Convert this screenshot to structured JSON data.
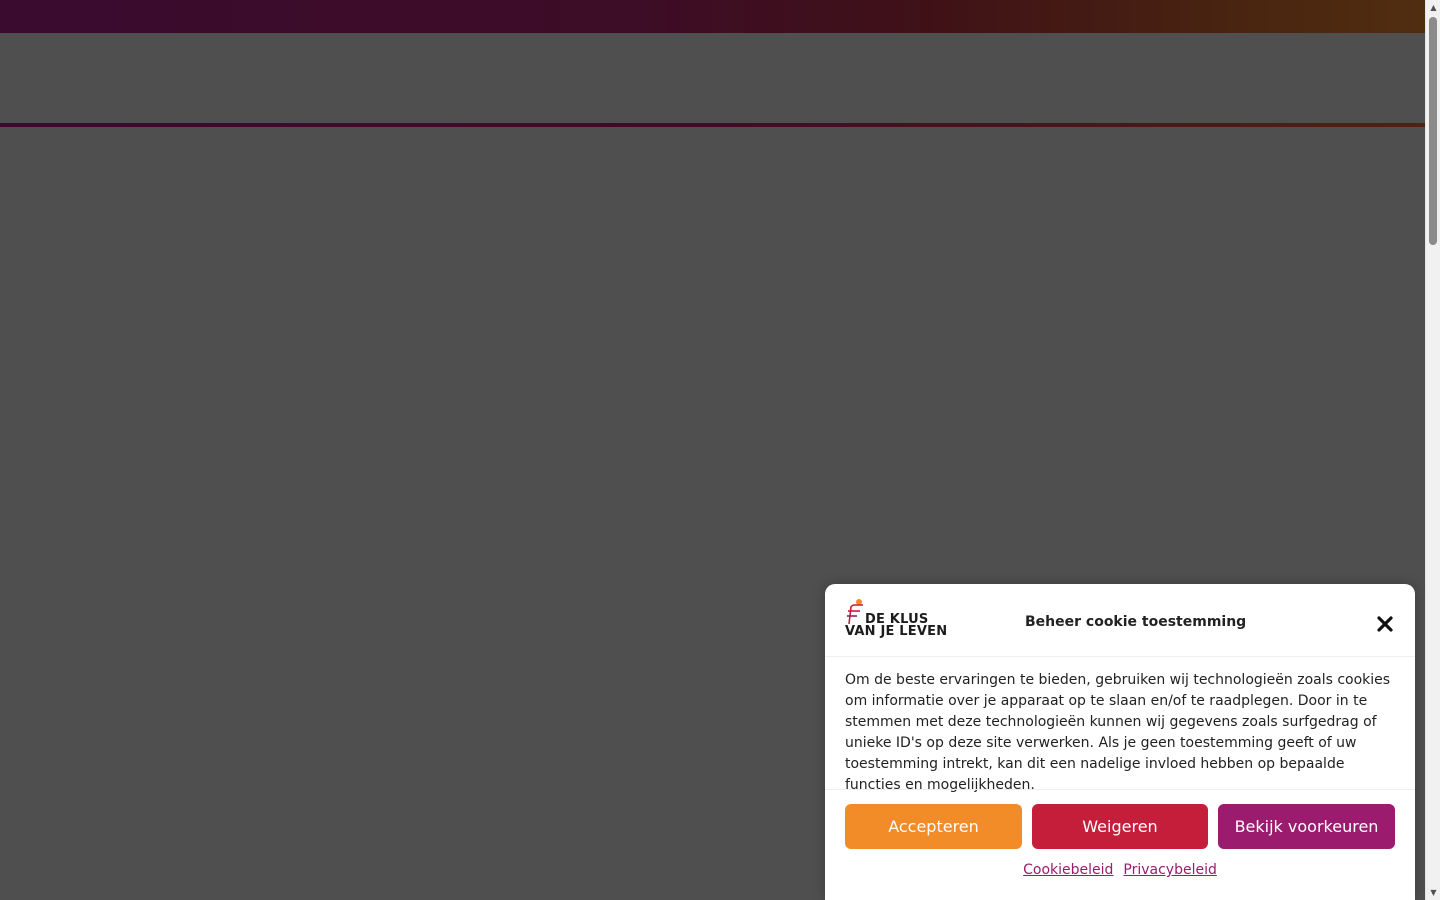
{
  "cookie": {
    "logo": {
      "line1": "DE KLUS",
      "line2": "VAN JE LEVEN"
    },
    "title": "Beheer cookie toestemming",
    "body": "Om de beste ervaringen te bieden, gebruiken wij technologieën zoals cookies om informatie over je apparaat op te slaan en/of te raadplegen. Door in te stemmen met deze technologieën kunnen wij gegevens zoals surfgedrag of unieke ID's op deze site verwerken. Als je geen toestemming geeft of uw toestemming intrekt, kan dit een nadelige invloed hebben op bepaalde functies en mogelijkheden.",
    "buttons": {
      "accept": "Accepteren",
      "deny": "Weigeren",
      "preferences": "Bekijk voorkeuren"
    },
    "links": {
      "cookie_policy": "Cookiebeleid",
      "privacy_policy": "Privacybeleid"
    }
  },
  "colors": {
    "accept": "#f28c28",
    "deny": "#c41e3a",
    "preferences": "#9b1b6e",
    "overlay": "#4f4f4f"
  },
  "icons": {
    "close": "close-icon",
    "logo": "brand-logo-icon"
  }
}
